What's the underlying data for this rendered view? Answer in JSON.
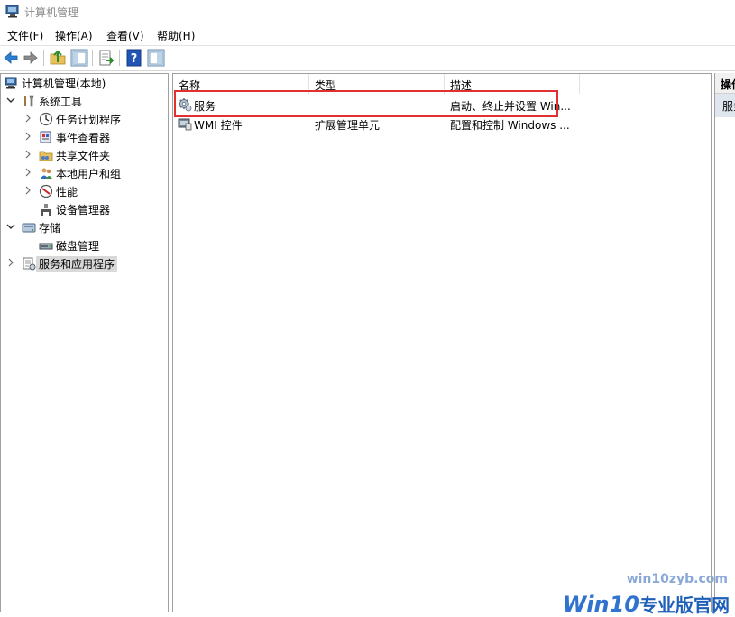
{
  "window": {
    "title": "计算机管理"
  },
  "menu": [
    {
      "label": "文件(F)"
    },
    {
      "label": "操作(A)"
    },
    {
      "label": "查看(V)"
    },
    {
      "label": "帮助(H)"
    }
  ],
  "toolbar": {
    "buttons": [
      "back-arrow-icon",
      "forward-arrow-icon",
      "up-folder-icon",
      "show-hide-tree-icon",
      "export-list-icon",
      "help-icon",
      "properties-icon"
    ]
  },
  "tree": [
    {
      "label": "计算机管理(本地)",
      "icon": "computer-management-icon",
      "level": 0,
      "expander": "none"
    },
    {
      "label": "系统工具",
      "icon": "tools-icon",
      "level": 1,
      "expander": "expanded"
    },
    {
      "label": "任务计划程序",
      "icon": "clock-icon",
      "level": 2,
      "expander": "collapsed"
    },
    {
      "label": "事件查看器",
      "icon": "event-viewer-icon",
      "level": 2,
      "expander": "collapsed"
    },
    {
      "label": "共享文件夹",
      "icon": "shared-folder-icon",
      "level": 2,
      "expander": "collapsed"
    },
    {
      "label": "本地用户和组",
      "icon": "users-icon",
      "level": 2,
      "expander": "collapsed"
    },
    {
      "label": "性能",
      "icon": "performance-icon",
      "level": 2,
      "expander": "collapsed"
    },
    {
      "label": "设备管理器",
      "icon": "device-manager-icon",
      "level": 2,
      "expander": "none"
    },
    {
      "label": "存储",
      "icon": "storage-icon",
      "level": 1,
      "expander": "expanded"
    },
    {
      "label": "磁盘管理",
      "icon": "disk-icon",
      "level": 2,
      "expander": "none"
    },
    {
      "label": "服务和应用程序",
      "icon": "services-apps-icon",
      "level": 1,
      "expander": "collapsed",
      "selected": true
    }
  ],
  "list": {
    "columns": [
      "名称",
      "类型",
      "描述"
    ],
    "rows": [
      {
        "name": "服务",
        "type": "",
        "desc": "启动、终止并设置 Win...",
        "icon": "gear-icon"
      },
      {
        "name": "WMI 控件",
        "type": "扩展管理单元",
        "desc": "配置和控制 Windows ...",
        "icon": "wmi-icon"
      }
    ]
  },
  "actions": {
    "header": "操作",
    "item": "服务"
  },
  "watermark": {
    "small": "win10zyb.com",
    "big_prefix": "Win10",
    "big_suffix": "专业版官网"
  },
  "colors": {
    "highlight": "#e0302f",
    "selected_bg": "#d9d9d9",
    "title_gray": "#8a8a8a"
  }
}
